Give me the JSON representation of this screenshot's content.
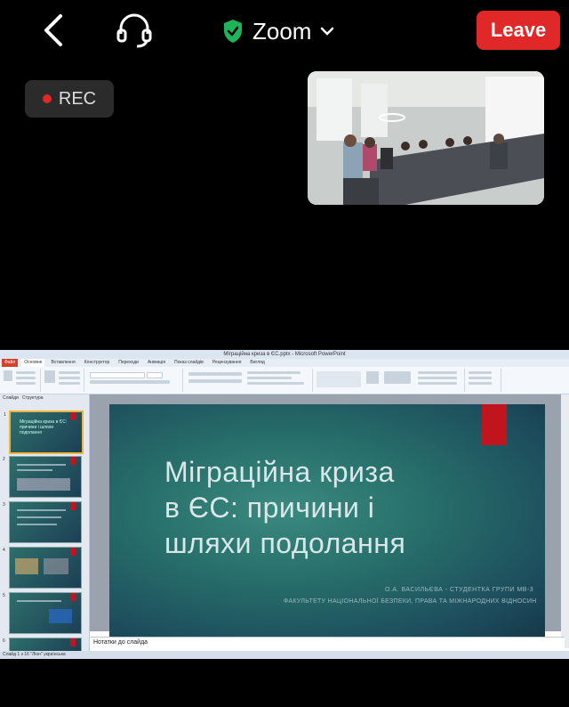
{
  "topbar": {
    "app_name": "Zoom",
    "leave_label": "Leave",
    "rec_label": "REC"
  },
  "colors": {
    "leave": "#e02828",
    "shield": "#1fb35a",
    "slide_accent": "#c0141e"
  },
  "powerpoint": {
    "window_title": "Міграційна криза в ЄС.pptx - Microsoft PowerPoint",
    "tabs": [
      "Файл",
      "Основне",
      "Вставлення",
      "Конструктор",
      "Переходи",
      "Анімація",
      "Показ слайдів",
      "Рецензування",
      "Вигляд"
    ],
    "pane_tabs": [
      "Слайди",
      "Структура"
    ],
    "slide_title_lines": [
      "Міграційна криза",
      "в ЄС: причини і",
      "шляхи подолання"
    ],
    "subtitle_1": "О.А. ВАСИЛЬЄВА - СТУДЕНТКА ГРУПИ МВ-3",
    "subtitle_2": "ФАКУЛЬТЕТУ НАЦІОНАЛЬНОЇ БЕЗПЕКИ, ПРАВА ТА МІЖНАРОДНИХ ВІДНОСИН",
    "notes_label": "Нотатки до слайда",
    "status": "Слайд 1 з 16   \"Ліон\"   українська",
    "thumbnails": [
      {
        "num": "1",
        "text": "Міграційна криза в ЄС: причини і шляхи подолання"
      },
      {
        "num": "2",
        "text": ""
      },
      {
        "num": "3",
        "text": ""
      },
      {
        "num": "4",
        "text": ""
      },
      {
        "num": "5",
        "text": ""
      },
      {
        "num": "6",
        "text": ""
      }
    ]
  }
}
